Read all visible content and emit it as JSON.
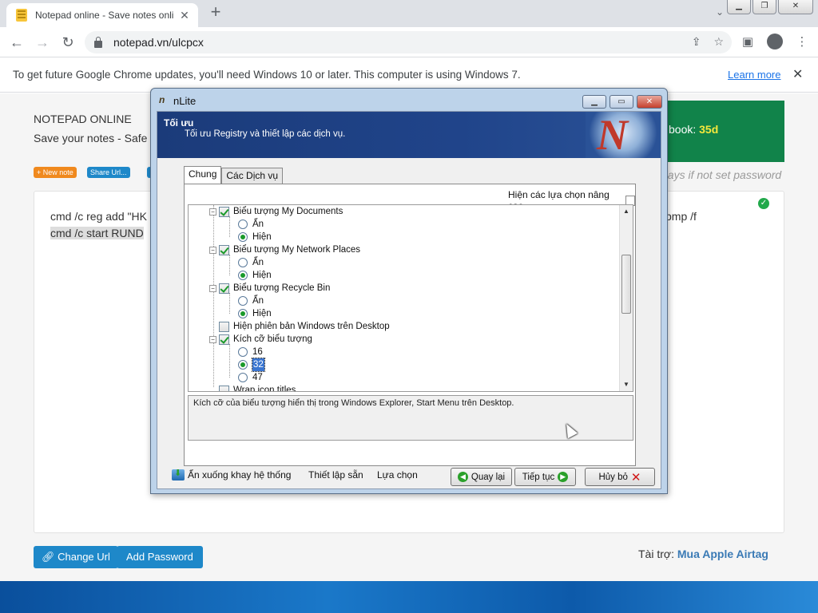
{
  "browser": {
    "tab_title": "Notepad online - Save notes onli",
    "url": "notepad.vn/ulcpcx",
    "infobar_text": "To get future Google Chrome updates, you'll need Windows 10 or later. This computer is using Windows 7.",
    "infobar_link": "Learn more"
  },
  "page": {
    "site_title": "NOTEPAD ONLINE",
    "site_sub": "Save your notes - Safe",
    "buttons": {
      "new_note": "+ New note",
      "share_url": "Share Url..."
    },
    "ad_text": "book: ",
    "ad_value": "35d",
    "hint": "days if not set password",
    "note_line1": "cmd /c reg add \"HK",
    "note_line2": "cmd /c start RUND",
    "note_line1_right": "bmp /f",
    "change_url": "Change Url",
    "add_password": "Add Password",
    "sponsor_label": "Tài trợ: ",
    "sponsor_link": "Mua Apple Airtag"
  },
  "dialog": {
    "title": "nLite",
    "header": "Tối ưu",
    "subheader": "Tối ưu Registry và thiết lập các dịch vụ.",
    "tabs": [
      "Chung",
      "Các Dịch vụ"
    ],
    "advanced_label": "Hiện các lựa chọn nâng cao",
    "tree": [
      {
        "label": "Biểu tượng My Documents",
        "kind": "check",
        "checked": true
      },
      {
        "label": "Ẩn",
        "kind": "radio",
        "checked": false
      },
      {
        "label": "Hiện",
        "kind": "radio",
        "checked": true
      },
      {
        "label": "Biểu tượng My Network Places",
        "kind": "check",
        "checked": true
      },
      {
        "label": "Ẩn",
        "kind": "radio",
        "checked": false
      },
      {
        "label": "Hiện",
        "kind": "radio",
        "checked": true
      },
      {
        "label": "Biểu tượng Recycle Bin",
        "kind": "check",
        "checked": true
      },
      {
        "label": "Ẩn",
        "kind": "radio",
        "checked": false
      },
      {
        "label": "Hiện",
        "kind": "radio",
        "checked": true
      },
      {
        "label": "Hiện phiên bản Windows trên Desktop",
        "kind": "check",
        "checked": false
      },
      {
        "label": "Kích cỡ biểu tượng",
        "kind": "check",
        "checked": true
      },
      {
        "label": "16",
        "kind": "radio",
        "checked": false
      },
      {
        "label": "32",
        "kind": "radio",
        "checked": true,
        "selected": true
      },
      {
        "label": "47",
        "kind": "radio",
        "checked": false
      },
      {
        "label": "Wrap icon titles",
        "kind": "check",
        "checked": false
      }
    ],
    "description": "Kích cỡ của biểu tượng hiển thị trong Windows Explorer, Start Menu  trên Desktop.",
    "footer": {
      "minimize_tray": "Ẩn xuống khay hệ thống",
      "presets": "Thiết lập sẵn",
      "options": "Lựa chọn",
      "back": "Quay lại",
      "next": "Tiếp tục",
      "cancel": "Hủy bỏ"
    }
  },
  "colors": {
    "accent_blue": "#1e88c9",
    "ad_green": "#11834a",
    "banner_navy": "#1b3b7a",
    "check_green": "#1a9a2a"
  },
  "icons": [
    "notepad-favicon",
    "lock-icon",
    "share-icon",
    "star-icon",
    "sidepanel-icon",
    "profile-icon",
    "menu-icon",
    "checkmark-icon",
    "tray-icon",
    "back-arrow-icon",
    "next-arrow-icon",
    "cancel-x-icon",
    "mouse-cursor"
  ]
}
